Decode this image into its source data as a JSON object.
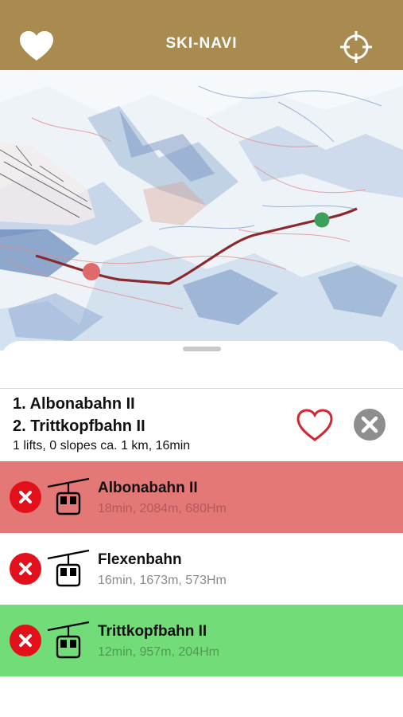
{
  "header": {
    "title": "SKI-NAVI",
    "favorites_icon": "heart-icon",
    "locate_icon": "crosshair-icon",
    "background_color": "#a98a4f"
  },
  "route": {
    "line1": "1. Albonabahn II",
    "line2": "2. Trittkopfbahn II",
    "summary": "1 lifts, 0 slopes ca. 1 km, 16min",
    "route_color": "#8b2a2c",
    "start_marker_color": "#e06a6a",
    "end_marker_color": "#3aa05a"
  },
  "segments": [
    {
      "title": "Albonabahn II",
      "detail": "18min, 2084m, 680Hm",
      "background": "#e37877",
      "detail_color": "#b45a5a"
    },
    {
      "title": "Flexenbahn",
      "detail": "16min, 1673m, 573Hm",
      "background": "#ffffff",
      "detail_color": "#8a8a8a"
    },
    {
      "title": "Trittkopfbahn II",
      "detail": "12min, 957m, 204Hm",
      "background": "#72dd78",
      "detail_color": "#4f9a54"
    }
  ]
}
